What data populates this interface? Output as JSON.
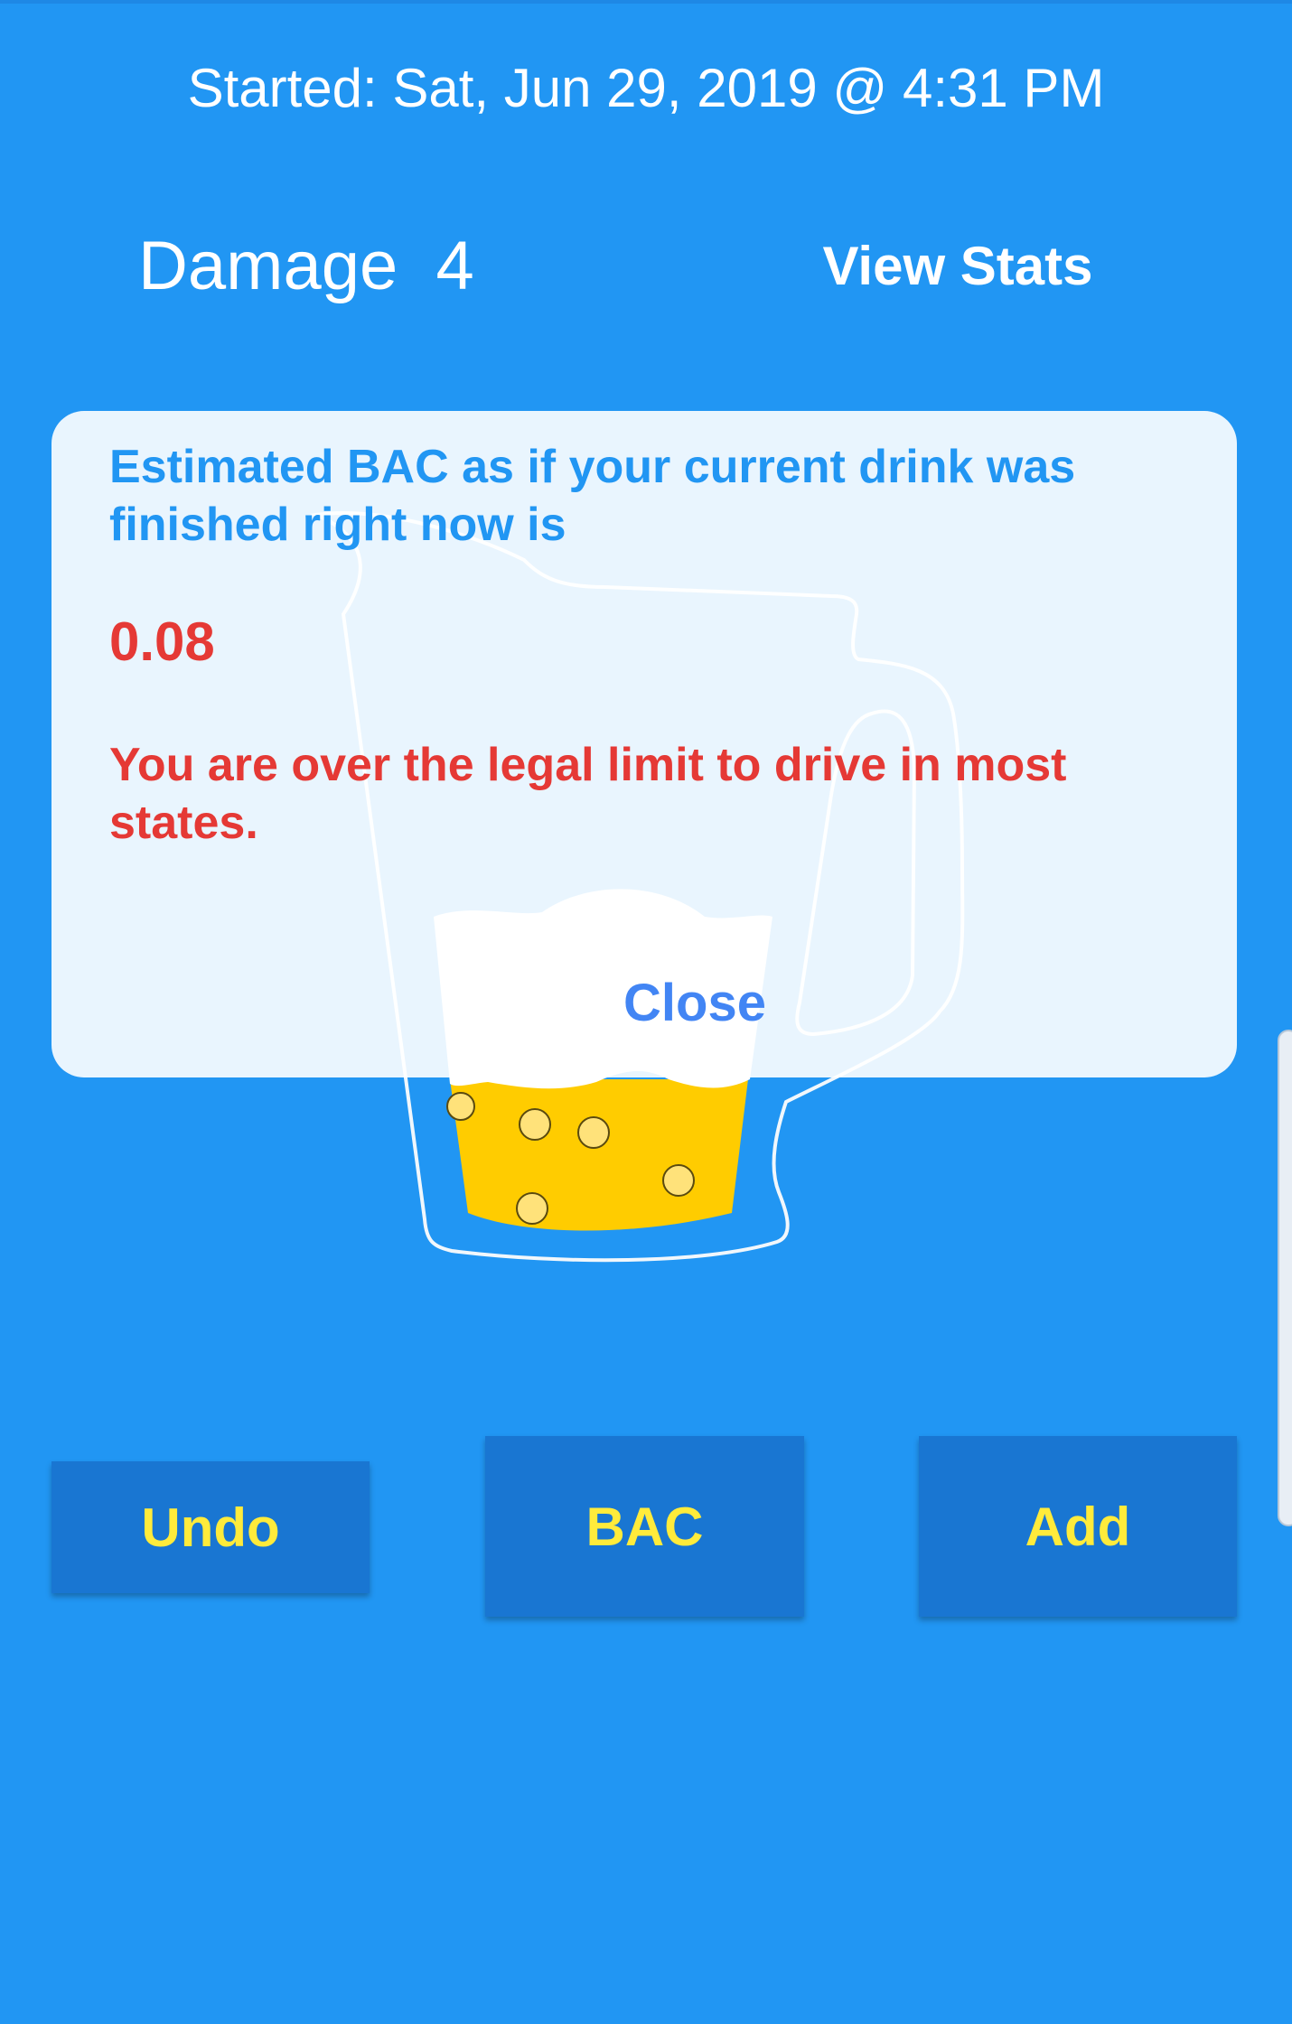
{
  "header": {
    "started": "Started: Sat, Jun 29, 2019 @ 4:31 PM"
  },
  "stats": {
    "damage_label": "Damage",
    "damage_value": "4",
    "view_stats_label": "View Stats"
  },
  "dialog": {
    "message": "Estimated BAC as if your current drink was finished right now is",
    "bac_value": "0.08",
    "warning": "You are over the legal limit to drive in most states.",
    "close_label": "Close"
  },
  "actions": {
    "undo_label": "Undo",
    "bac_label": "BAC",
    "add_label": "Add"
  },
  "colors": {
    "background": "#2196F3",
    "button": "#1976D2",
    "button_text": "#FFEB3B",
    "dialog_text": "#2196F3",
    "warning_text": "#E53935",
    "beer": "#FFCC00",
    "foam": "#FFFFFF"
  },
  "icons": {
    "mug": "beer-mug-icon"
  }
}
